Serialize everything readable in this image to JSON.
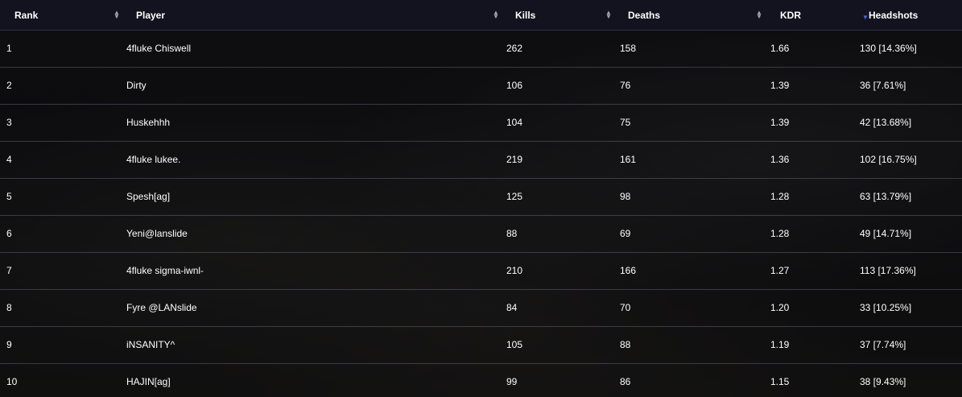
{
  "columns": {
    "rank": "Rank",
    "player": "Player",
    "kills": "Kills",
    "deaths": "Deaths",
    "kdr": "KDR",
    "headshots": "Headshots"
  },
  "rows": [
    {
      "rank": "1",
      "player": "4fluke Chiswell",
      "kills": "262",
      "deaths": "158",
      "kdr": "1.66",
      "headshots": "130 [14.36%]"
    },
    {
      "rank": "2",
      "player": "Dirty",
      "kills": "106",
      "deaths": "76",
      "kdr": "1.39",
      "headshots": "36 [7.61%]"
    },
    {
      "rank": "3",
      "player": "Huskehhh",
      "kills": "104",
      "deaths": "75",
      "kdr": "1.39",
      "headshots": "42 [13.68%]"
    },
    {
      "rank": "4",
      "player": "4fluke lukee.",
      "kills": "219",
      "deaths": "161",
      "kdr": "1.36",
      "headshots": "102 [16.75%]"
    },
    {
      "rank": "5",
      "player": "Spesh[ag]",
      "kills": "125",
      "deaths": "98",
      "kdr": "1.28",
      "headshots": "63 [13.79%]"
    },
    {
      "rank": "6",
      "player": "Yeni@lanslide",
      "kills": "88",
      "deaths": "69",
      "kdr": "1.28",
      "headshots": "49 [14.71%]"
    },
    {
      "rank": "7",
      "player": "4fluke sigma-iwnl-",
      "kills": "210",
      "deaths": "166",
      "kdr": "1.27",
      "headshots": "113 [17.36%]"
    },
    {
      "rank": "8",
      "player": "Fyre @LANslide",
      "kills": "84",
      "deaths": "70",
      "kdr": "1.20",
      "headshots": "33 [10.25%]"
    },
    {
      "rank": "9",
      "player": "iNSANITY^",
      "kills": "105",
      "deaths": "88",
      "kdr": "1.19",
      "headshots": "37 [7.74%]"
    },
    {
      "rank": "10",
      "player": "HAJIN[ag]",
      "kills": "99",
      "deaths": "86",
      "kdr": "1.15",
      "headshots": "38 [9.43%]"
    }
  ],
  "sort": {
    "column": "kdr",
    "direction": "desc"
  },
  "colors": {
    "header_bg": "#121420",
    "sort_active": "#4d6fd1",
    "sort_idle": "#9ea3b5",
    "row_divider": "#5a5c69"
  },
  "icons": {
    "sort_both": "sort-both-icon",
    "sort_desc": "sort-desc-icon"
  }
}
